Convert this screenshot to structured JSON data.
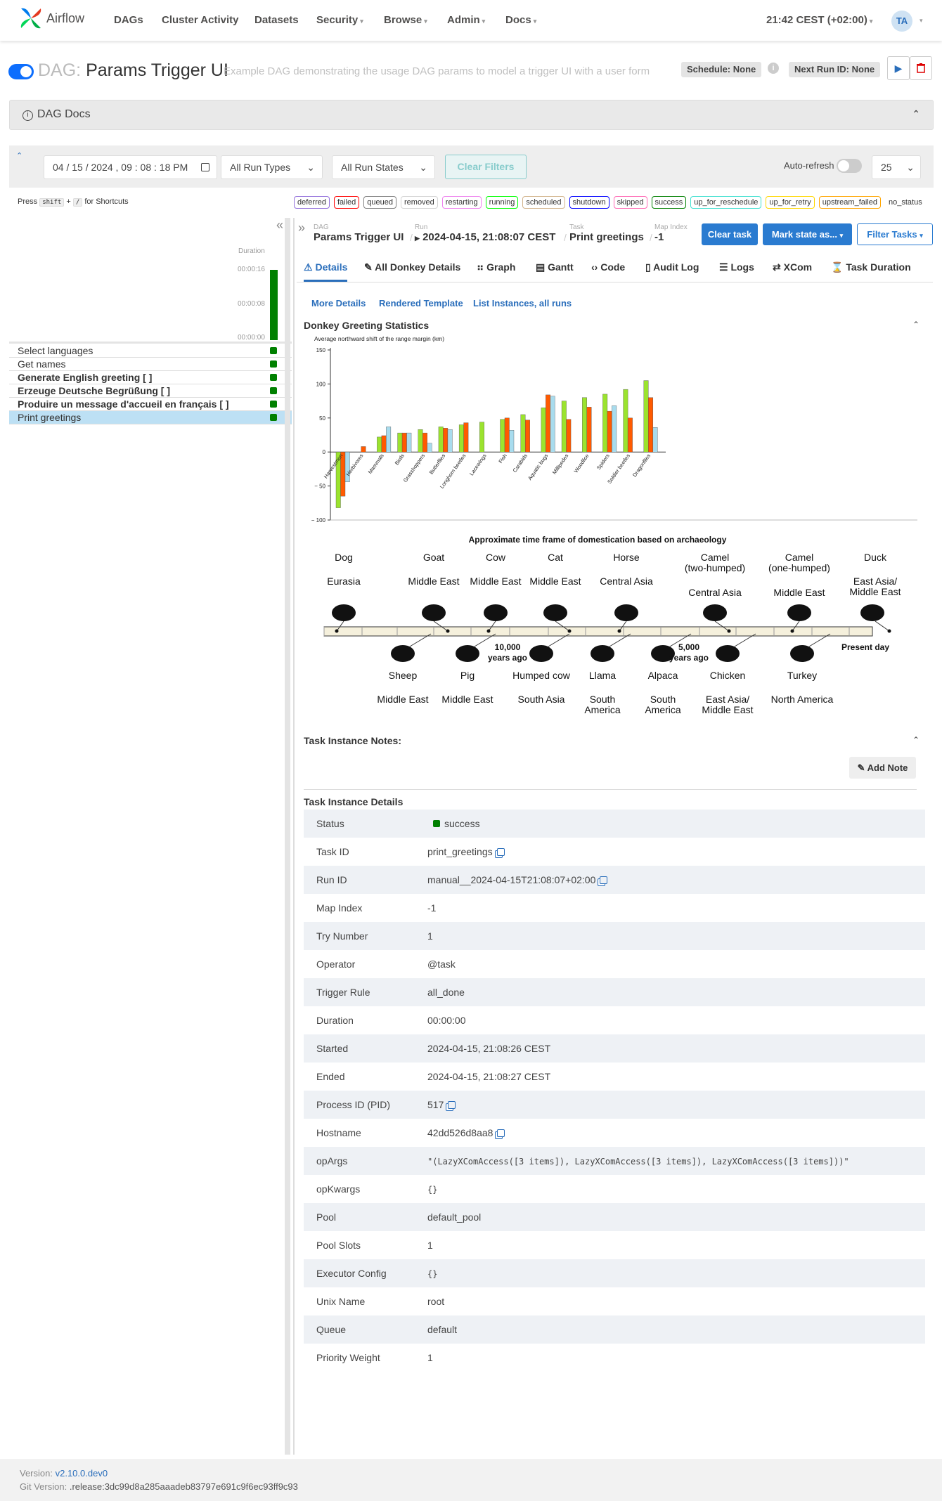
{
  "nav": {
    "brand": "Airflow",
    "items": [
      "DAGs",
      "Cluster Activity",
      "Datasets",
      "Security",
      "Browse",
      "Admin",
      "Docs"
    ],
    "clock": "21:42 CEST (+02:00)",
    "avatar": "TA"
  },
  "dag": {
    "prefix": "DAG:",
    "name": "Params Trigger UI",
    "description": "Example DAG demonstrating the usage DAG params to model a trigger UI with a user form",
    "schedule": "Schedule: None",
    "next_run": "Next Run ID: None",
    "docs": "DAG Docs"
  },
  "filters": {
    "date": "04 / 15 / 2024 ,  09 : 08 : 18   PM",
    "run_types": "All Run Types",
    "run_states": "All Run States",
    "clear": "Clear Filters",
    "auto_refresh": "Auto-refresh",
    "count": "25"
  },
  "shortcuts": {
    "press": "Press",
    "key1": "shift",
    "plus": "+",
    "key2": "/",
    "for": "for Shortcuts"
  },
  "states": [
    {
      "label": "deferred",
      "color": "#9370db"
    },
    {
      "label": "failed",
      "color": "#ff0000"
    },
    {
      "label": "queued",
      "color": "#808080"
    },
    {
      "label": "removed",
      "color": "#d3d3d3"
    },
    {
      "label": "restarting",
      "color": "#ee82ee"
    },
    {
      "label": "running",
      "color": "#00ff00"
    },
    {
      "label": "scheduled",
      "color": "#d2b48c"
    },
    {
      "label": "shutdown",
      "color": "#0000ff"
    },
    {
      "label": "skipped",
      "color": "#ff69b4"
    },
    {
      "label": "success",
      "color": "#008000"
    },
    {
      "label": "up_for_reschedule",
      "color": "#40e0d0"
    },
    {
      "label": "up_for_retry",
      "color": "#ffd700"
    },
    {
      "label": "upstream_failed",
      "color": "#ffa500"
    },
    {
      "label": "no_status",
      "color": "#ffffff"
    }
  ],
  "grid": {
    "duration_label": "Duration",
    "ticks": [
      "00:00:16",
      "00:00:08",
      "00:00:00"
    ],
    "tasks": [
      {
        "label": "Select languages",
        "bold": false
      },
      {
        "label": "Get names",
        "bold": false
      },
      {
        "label": "Generate English greeting [ ]",
        "bold": true
      },
      {
        "label": "Erzeuge Deutsche Begrüßung [ ]",
        "bold": true
      },
      {
        "label": "Produire un message d'accueil en français [ ]",
        "bold": true
      },
      {
        "label": "Print greetings",
        "bold": false,
        "selected": true
      }
    ]
  },
  "breadcrumb": {
    "dag_k": "DAG",
    "dag_v": "Params Trigger UI",
    "run_k": "Run",
    "run_v": "2024-04-15, 21:08:07 CEST",
    "task_k": "Task",
    "task_v": "Print greetings",
    "map_k": "Map Index",
    "map_v": "-1"
  },
  "actions": {
    "clear": "Clear task",
    "mark": "Mark state as...",
    "filter": "Filter Tasks"
  },
  "tabs": [
    "Details",
    "All Donkey Details",
    "Graph",
    "Gantt",
    "Code",
    "Audit Log",
    "Logs",
    "XCom",
    "Task Duration"
  ],
  "sublinks": [
    "More Details",
    "Rendered Template",
    "List Instances, all runs"
  ],
  "stats_title": "Donkey Greeting Statistics",
  "chart_data": {
    "type": "bar",
    "title": "",
    "ylabel": "Average northward shift of the range margin (km)",
    "ylim": [
      -100,
      150
    ],
    "yticks": [
      150,
      100,
      50,
      0,
      -50,
      -100
    ],
    "ytick_labels": [
      "150",
      "100",
      "50",
      "0",
      "− 50",
      "− 100"
    ],
    "categories": [
      "Harvestmen",
      "Herbivores",
      "Mammals",
      "Birds",
      "Grasshoppers",
      "Butterflies",
      "Longhorn beetles",
      "Lacewings",
      "Fish",
      "Carabids",
      "Aquatic bugs",
      "Millipedes",
      "Woodlice",
      "Spiders",
      "Soldier beetles",
      "Dragonflies"
    ],
    "series": [
      {
        "color": "#9be32e",
        "values": [
          -82,
          0,
          22,
          28,
          33,
          37,
          40,
          44,
          48,
          55,
          65,
          75,
          80,
          85,
          92,
          105
        ]
      },
      {
        "color": "#ff5a00",
        "values": [
          -65,
          8,
          24,
          28,
          28,
          35,
          43,
          0,
          50,
          47,
          84,
          48,
          66,
          60,
          50,
          80
        ]
      },
      {
        "color": "#a8dcee",
        "values": [
          -44,
          0,
          37,
          28,
          13,
          33,
          0,
          0,
          32,
          0,
          82,
          0,
          0,
          68,
          0,
          36
        ]
      }
    ]
  },
  "timeline": {
    "title": "Approximate time frame of domestication based on archaeology",
    "top": [
      {
        "animal": "Dog",
        "region": "Eurasia"
      },
      {
        "animal": "Goat",
        "region": "Middle East"
      },
      {
        "animal": "Cow",
        "region": "Middle East"
      },
      {
        "animal": "Cat",
        "region": "Middle East"
      },
      {
        "animal": "Horse",
        "region": "Central Asia"
      },
      {
        "animal": "Camel\n(two-humped)",
        "region": "Central Asia"
      },
      {
        "animal": "Camel\n(one-humped)",
        "region": "Middle East"
      },
      {
        "animal": "Duck",
        "region": "East Asia/\nMiddle East"
      }
    ],
    "bottom": [
      {
        "animal": "Sheep",
        "region": "Middle East"
      },
      {
        "animal": "Pig",
        "region": "Middle East"
      },
      {
        "animal": "Humped cow",
        "region": "South Asia"
      },
      {
        "animal": "Llama",
        "region": "South\nAmerica"
      },
      {
        "animal": "Alpaca",
        "region": "South\nAmerica"
      },
      {
        "animal": "Chicken",
        "region": "East Asia/\nMiddle East"
      },
      {
        "animal": "Turkey",
        "region": "North America"
      }
    ],
    "markers": [
      "10,000\nyears ago",
      "5,000\nyears ago",
      "Present day"
    ]
  },
  "notes": {
    "title": "Task Instance Notes:",
    "add": "Add Note"
  },
  "details": {
    "title": "Task Instance Details",
    "rows": [
      {
        "k": "Status",
        "v": "success"
      },
      {
        "k": "Task ID",
        "v": "print_greetings",
        "copy": true
      },
      {
        "k": "Run ID",
        "v": "manual__2024-04-15T21:08:07+02:00",
        "copy": true
      },
      {
        "k": "Map Index",
        "v": "-1"
      },
      {
        "k": "Try Number",
        "v": "1"
      },
      {
        "k": "Operator",
        "v": "@task"
      },
      {
        "k": "Trigger Rule",
        "v": "all_done"
      },
      {
        "k": "Duration",
        "v": "00:00:00"
      },
      {
        "k": "Started",
        "v": "2024-04-15, 21:08:26 CEST"
      },
      {
        "k": "Ended",
        "v": "2024-04-15, 21:08:27 CEST"
      },
      {
        "k": "Process ID (PID)",
        "v": "517",
        "copy": true
      },
      {
        "k": "Hostname",
        "v": "42dd526d8aa8",
        "copy": true
      },
      {
        "k": "opArgs",
        "v": "\"(LazyXComAccess([3 items]), LazyXComAccess([3 items]), LazyXComAccess([3 items]))\"",
        "mono": true
      },
      {
        "k": "opKwargs",
        "v": "{}",
        "mono": true
      },
      {
        "k": "Pool",
        "v": "default_pool"
      },
      {
        "k": "Pool Slots",
        "v": "1"
      },
      {
        "k": "Executor Config",
        "v": "{}",
        "mono": true
      },
      {
        "k": "Unix Name",
        "v": "root"
      },
      {
        "k": "Queue",
        "v": "default"
      },
      {
        "k": "Priority Weight",
        "v": "1"
      }
    ]
  },
  "footer": {
    "version_k": "Version:",
    "version_v": "v2.10.0.dev0",
    "git_k": "Git Version:",
    "git_v": ".release:3dc99d8a285aaadeb83797e691c9f6ec93ff9c93"
  }
}
